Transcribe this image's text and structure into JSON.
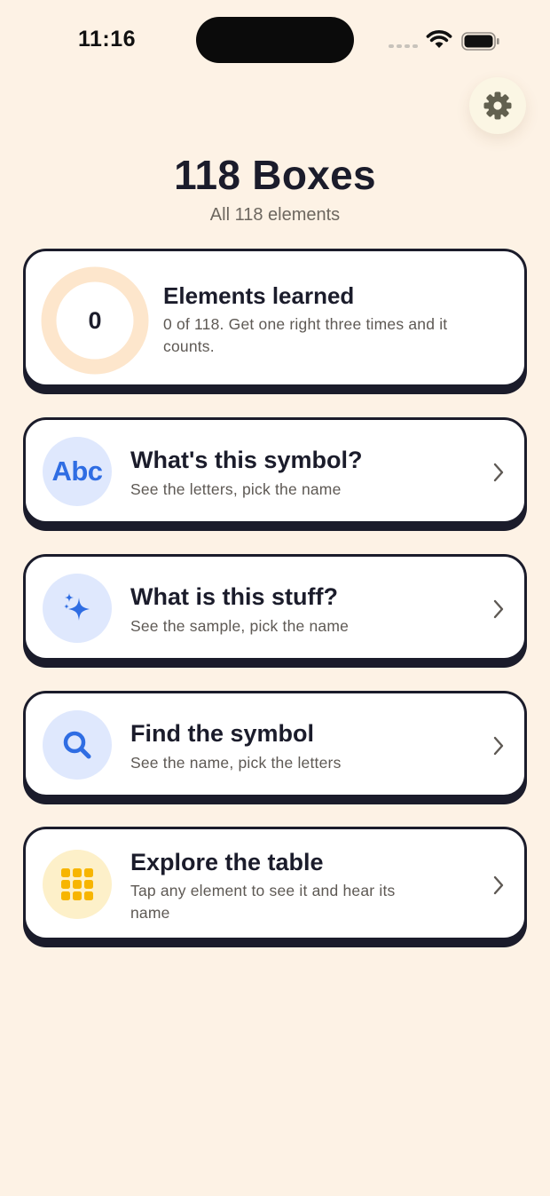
{
  "status_bar": {
    "time": "11:16"
  },
  "header": {
    "title": "118 Boxes",
    "subtitle": "All 118 elements"
  },
  "progress_card": {
    "count": "0",
    "learned_fraction": 0,
    "title": "Elements learned",
    "description": "0 of 118. Get one right three times and it counts."
  },
  "modes": [
    {
      "icon": "abc-icon",
      "icon_text": "Abc",
      "title": "What's this symbol?",
      "description": "See the letters, pick the name"
    },
    {
      "icon": "sparkles-icon",
      "title": "What is this stuff?",
      "description": "See the sample, pick the name"
    },
    {
      "icon": "magnifier-icon",
      "title": "Find the symbol",
      "description": "See the name, pick the letters"
    },
    {
      "icon": "grid-icon",
      "title": "Explore the table",
      "description": "Tap any element to see it and hear its name"
    }
  ],
  "colors": {
    "background": "#fdf2e5",
    "ink": "#1b1c2b",
    "accent_blue": "#2f6de3",
    "accent_yellow": "#f7b500",
    "progress_track": "#fde6cc"
  }
}
